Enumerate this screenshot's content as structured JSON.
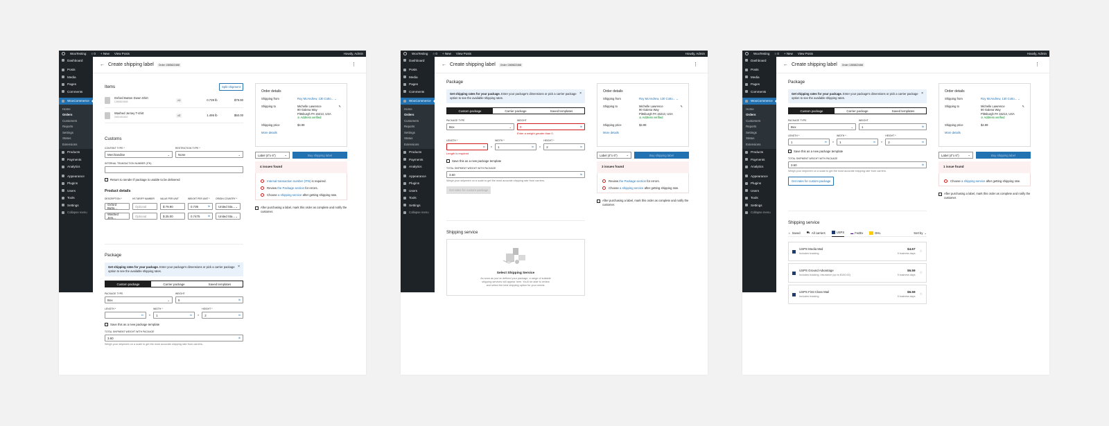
{
  "adminbar": {
    "site": "WooTesting",
    "comments": "0",
    "new": "New",
    "view_posts": "View Posts",
    "howdy": "Howdy, Admin"
  },
  "sidebar": {
    "top": [
      {
        "label": "Dashboard"
      }
    ],
    "items": [
      {
        "label": "Posts"
      },
      {
        "label": "Media"
      },
      {
        "label": "Pages"
      },
      {
        "label": "Comments"
      }
    ],
    "woocommerce": "WooCommerce",
    "sub": [
      "Home",
      "Orders",
      "Customers",
      "Reports",
      "Settings",
      "Status",
      "Extensions"
    ],
    "items2": [
      {
        "label": "Products"
      },
      {
        "label": "Payments"
      },
      {
        "label": "Analytics"
      }
    ],
    "items3": [
      {
        "label": "Appearance"
      },
      {
        "label": "Plugins"
      },
      {
        "label": "Users"
      },
      {
        "label": "Tools"
      },
      {
        "label": "Settings"
      }
    ],
    "collapse": "Collapse menu"
  },
  "header": {
    "back": "←",
    "title": "Create shipping label",
    "order": "Order 1365822468",
    "more": "⋮"
  },
  "items": {
    "title": "Items",
    "split": "Split shipment",
    "rows": [
      {
        "name": "Oxford Button Down Shirt",
        "sku": "1365822468",
        "qty": "×1",
        "weight": "0.739 lb",
        "price": "$79.90"
      },
      {
        "name": "Washed Jersey T-shirt",
        "sku": "2652451482",
        "qty": "×2",
        "weight": "1.495 lb",
        "price": "$50.00"
      }
    ]
  },
  "customs": {
    "title": "Customs",
    "content_type_label": "CONTENT TYPE *",
    "content_type": "Merchandise",
    "restriction_label": "RESTRICTION TYPE *",
    "restriction": "None",
    "itn_label": "INTERNAL TRANSACTION NUMBER (ITN)",
    "return_label": "Return to sender if package is unable to be delivered",
    "pd_title": "Product details",
    "pd_headers": [
      "DESCRIPTION *",
      "HS TARIFF NUMBER",
      "VALUE PER UNIT",
      "WEIGHT PER UNIT *",
      "ORIGIN COUNTRY *"
    ],
    "pd_rows": [
      {
        "desc": "Oxford Butto...",
        "hs": "Optional",
        "value": "$ 79.90",
        "weight": "0.739",
        "origin": "United Sta..."
      },
      {
        "desc": "Washed Jers...",
        "hs": "Optional",
        "value": "$ 25.00",
        "weight": "0.7475",
        "origin": "United Sta..."
      }
    ]
  },
  "package": {
    "title": "Package",
    "notice_bold": "Get shipping rates for your package.",
    "notice_text": " Enter your package's dimensions or pick a carrier package option to see the available shipping rates.",
    "tabs": [
      "Custom package",
      "Carrier package",
      "Saved templates"
    ],
    "type_label": "PACKAGE TYPE",
    "type": "Box",
    "weight_label": "WEIGHT",
    "weight_value": "5",
    "weight_err_value": "0",
    "weight_err": "Enter a weight greater than 0.",
    "length_label": "LENGTH *",
    "width_label": "WIDTH *",
    "height_label": "HEIGHT *",
    "length": "",
    "width": "1",
    "height": "2",
    "length3": "1",
    "length_err": "Length is required",
    "unit_in": "in",
    "unit_lb": "lb",
    "times": "×",
    "save_template": "Save this as a new package template",
    "total_label": "TOTAL SHIPMENT WEIGHT WITH PACKAGE",
    "total": "3.60",
    "total_hint": "Weigh your shipment on a scale to get the most accurate shipping rate from carriers.",
    "get_rates": "Get rates for custom package"
  },
  "order": {
    "title": "Order details",
    "from_label": "Shipping from",
    "from": "Roy McAndrew, 130 Cotto...",
    "to_label": "Shipping to",
    "to_name": "Michelle Lawrence",
    "to_street": "90 Galena Way",
    "to_city": "Pittsburgh PA 15213, USA",
    "verified": "Address verified",
    "price_label": "Shipping price",
    "price": "$4.99",
    "more": "More details"
  },
  "actions": {
    "label_size": "Label (4\"x 6\")",
    "buy": "Buy shipping label"
  },
  "issues": {
    "s1_title": "4 issues found",
    "s2_title": "3 issues found",
    "s3_title": "1 issue found",
    "itn_link": "Internal transaction number (ITN)",
    "itn_rest": " is required.",
    "review_pre": "Review ",
    "review_link": "the Package section",
    "review_post": " for errors.",
    "choose_pre": "Choose ",
    "choose_link": "a shipping service",
    "choose_post": " after getting shipping rate."
  },
  "complete": "After purchasing a label, mark this order as complete and notify the customer.",
  "service": {
    "title": "Shipping service",
    "empty_title": "Select Shipping Service",
    "empty_text": "As soon as you've defined your package, a range of suitable shipping services will appear here. You'll be able to review and select the best shipping option for your needs.",
    "tabs": [
      "Saved",
      "All carriers",
      "USPS",
      "FedEx",
      "DHL"
    ],
    "sort": "Sort by",
    "rates": [
      {
        "name": "USPS Media Mail",
        "desc": "Includes tracking",
        "price": "$4.67",
        "days": "5 business days"
      },
      {
        "name": "USPS Ground Advantage",
        "desc": "Includes tracking, insurance (up to $100.00)",
        "price": "$6.59",
        "days": "5 business days"
      },
      {
        "name": "USPS First Class Mail",
        "desc": "Includes tracking",
        "price": "$6.59",
        "days": "5 business days"
      }
    ]
  }
}
